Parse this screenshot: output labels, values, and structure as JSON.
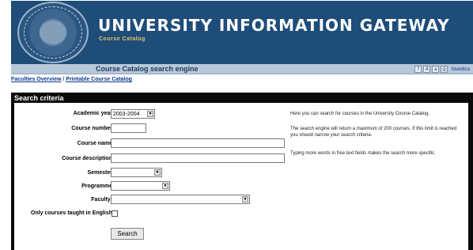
{
  "header": {
    "title": "UNIVERSITY INFORMATION GATEWAY",
    "subtitle": "Course Catalog",
    "seal_icon": "university-seal",
    "colors": {
      "banner": "#1e4d7a",
      "subbar": "#b8c8da",
      "subtitle": "#e3c76a"
    }
  },
  "subbar": {
    "title": "Course Catalog search engine",
    "tools": [
      "?",
      "A",
      "a",
      "⎙"
    ],
    "language_link": "Islandica"
  },
  "breadcrumbs": {
    "item1": "Faculties Overview",
    "separator": "/",
    "item2": "Printable Course Catalog"
  },
  "search": {
    "panel_title": "Search criteria",
    "fields": {
      "academic_year_label": "Academic year",
      "academic_year_value": "2003-2004",
      "course_number_label": "Course number",
      "course_number_value": "",
      "course_name_label": "Course name",
      "course_name_value": "",
      "course_description_label": "Course description",
      "course_description_value": "",
      "semester_label": "Semester",
      "semester_value": "",
      "programme_label": "Programme",
      "programme_value": "",
      "faculty_label": "Faculty:",
      "faculty_value": "",
      "english_only_label": "Only courses taught in English",
      "english_only_checked": false
    },
    "button_label": "Search",
    "help": {
      "p1": "Here you can search for courses in the University Course Catalog.",
      "p2": "The search engine will return a maximum of 200 courses. If this limit is reached you should narrow your search criteria.",
      "p3": "Typing more words in free text fields makes the search more specific."
    }
  }
}
